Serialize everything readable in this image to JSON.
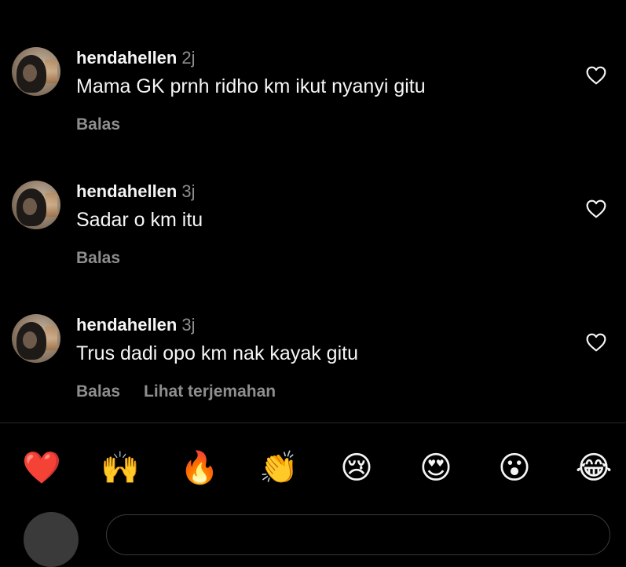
{
  "comments": [
    {
      "username": "hendahellen",
      "time": "2j",
      "text": "Mama GK prnh ridho km ikut nyanyi gitu",
      "reply_label": "Balas"
    },
    {
      "username": "hendahellen",
      "time": "3j",
      "text": "Sadar o km itu",
      "reply_label": "Balas"
    },
    {
      "username": "hendahellen",
      "time": "3j",
      "text": "Trus dadi opo km nak kayak gitu",
      "reply_label": "Balas",
      "translate_label": "Lihat terjemahan"
    }
  ],
  "quick_reactions": [
    "❤️",
    "🙌",
    "🔥",
    "👏",
    "😢",
    "😍",
    "😮",
    "😂"
  ],
  "colors": {
    "background": "#000000",
    "primary_text": "#f5f5f5",
    "secondary_text": "#8e8e8e",
    "divider": "#262626"
  }
}
